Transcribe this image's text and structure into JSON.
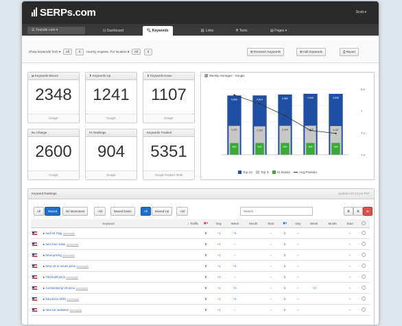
{
  "app": {
    "logo": "SERPs.com",
    "user": "Scott"
  },
  "nav": {
    "site_select": "Yoursite.com",
    "tabs": [
      "Dashboard",
      "Keywords",
      "Links",
      "Tests",
      "Pages"
    ],
    "active": "Keywords"
  },
  "toolbar": {
    "filter_text_1": "Show keywords from",
    "filter_val_1": "All",
    "filter_text_2": "country engines. For location",
    "filter_val_2": "All",
    "research": "Research Keywords",
    "add": "Add Keywords",
    "report": "Report"
  },
  "stats": [
    {
      "label": "Keywords Moved",
      "value": "2348",
      "foot": "Google"
    },
    {
      "label": "Keywords Up",
      "value": "1241",
      "foot": "Google"
    },
    {
      "label": "Keywords Down",
      "value": "1107",
      "foot": "Google"
    },
    {
      "label": "No Change",
      "value": "2600",
      "foot": "Google"
    },
    {
      "label": "#1 Rankings",
      "value": "904",
      "foot": "Google"
    },
    {
      "label": "Keywords Tracked",
      "value": "5351",
      "foot": "Google Ranked: 5645"
    }
  ],
  "chart_title": "Weekly Averages - Google",
  "chart_data": {
    "type": "bar",
    "categories": [
      "",
      "",
      "",
      "",
      ""
    ],
    "series": [
      {
        "name": "Top 10",
        "values": [
          4509,
          4514,
          4582,
          4640,
          4636
        ]
      },
      {
        "name": "Top 3",
        "values": [
          2201,
          2163,
          2204,
          2212,
          2187
        ]
      },
      {
        "name": "#1 Ranks",
        "values": [
          900,
          902,
          904,
          904,
          904
        ]
      }
    ],
    "avg_position": [
      6.2,
      6.5,
      6.9,
      7.4,
      7.5
    ],
    "right_axis_ticks": [
      "6.6",
      "7",
      "7.2",
      "7.4"
    ],
    "colors": {
      "top10": "#1f4fa3",
      "top3": "#c8c8c8",
      "first": "#3aaa3a",
      "line": "#333333"
    },
    "legend": [
      "Top 10",
      "Top 3",
      "#1 Ranks",
      "Avg Position"
    ]
  },
  "rankings": {
    "title": "Keyword Rankings",
    "updated": "Updated 02:13 pm PST",
    "filters": [
      "All",
      "Moved",
      "No Movement",
      "+10",
      "Moved Down",
      "All",
      "Moved Up",
      "+10"
    ],
    "search_placeholder": "Search",
    "headers": [
      "Keyword",
      "Traffic",
      "Day",
      "Week",
      "Month",
      "Start",
      "Day",
      "Week",
      "Month",
      "Start"
    ],
    "rows": [
      {
        "kw": "audi s4 mpg",
        "url": "/some/path",
        "g": "5",
        "gd": "+1",
        "gw": "+1",
        "gm": "",
        "gs": "--",
        "b": "1",
        "bd": "--",
        "bw": "",
        "bm": "",
        "bs": "--"
      },
      {
        "kw": "auto true value",
        "url": "/some/path",
        "g": "5",
        "gd": "+2",
        "gw": "--",
        "gm": "",
        "gs": "--",
        "b": "1",
        "bd": "--",
        "bw": "",
        "bm": "",
        "bs": "--"
      },
      {
        "kw": "bmw pricing",
        "url": "/some/path",
        "g": "5",
        "gd": "+1",
        "gw": "--",
        "gm": "",
        "gs": "--",
        "b": "1",
        "bd": "--",
        "bw": "",
        "bm": "",
        "bs": "--"
      },
      {
        "kw": "bmw x5 m series price",
        "url": "/some/path",
        "g": "5",
        "gd": "+1",
        "gw": "+1",
        "gm": "",
        "gs": "--",
        "b": "1",
        "bd": "--",
        "bw": "",
        "bm": "",
        "bs": "--"
      },
      {
        "kw": "chevrolet price",
        "url": "/some/path",
        "g": "5",
        "gd": "+3",
        "gw": "--",
        "gm": "",
        "gs": "--",
        "b": "1",
        "bd": "--",
        "bw": "",
        "bm": "",
        "bs": "--"
      },
      {
        "kw": "continental gt v8 price",
        "url": "/some/path",
        "g": "5",
        "gd": "+1",
        "gw": "+1",
        "gm": "",
        "gs": "--",
        "b": "1",
        "bd": "--",
        "bw": "+2",
        "bm": "",
        "bs": "--"
      },
      {
        "kw": "kia prices 2010",
        "url": "/some/path",
        "g": "5",
        "gd": "+1",
        "gw": "+1",
        "gm": "",
        "gs": "--",
        "b": "1",
        "bd": "--",
        "bw": "",
        "bm": "",
        "bs": "--"
      },
      {
        "kw": "new car websites",
        "url": "/some/path",
        "g": "5",
        "gd": "+1",
        "gw": "--",
        "gm": "",
        "gs": "--",
        "b": "1",
        "bd": "--",
        "bw": "",
        "bm": "",
        "bs": "--"
      }
    ]
  }
}
